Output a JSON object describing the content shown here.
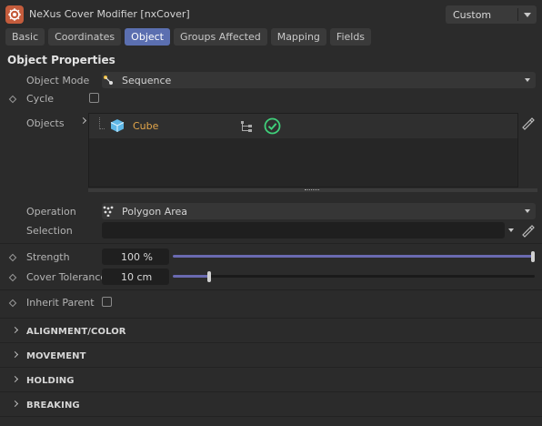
{
  "window": {
    "title": "NeXus Cover Modifier [nxCover]",
    "preset": "Custom"
  },
  "tabs": [
    {
      "label": "Basic",
      "active": false
    },
    {
      "label": "Coordinates",
      "active": false
    },
    {
      "label": "Object",
      "active": true
    },
    {
      "label": "Groups Affected",
      "active": false
    },
    {
      "label": "Mapping",
      "active": false
    },
    {
      "label": "Fields",
      "active": false
    }
  ],
  "section_title": "Object Properties",
  "object_mode": {
    "label": "Object Mode",
    "value": "Sequence"
  },
  "cycle": {
    "label": "Cycle",
    "checked": false
  },
  "objects": {
    "label": "Objects",
    "items": [
      {
        "name": "Cube",
        "enabled": true
      }
    ]
  },
  "operation": {
    "label": "Operation",
    "value": "Polygon Area"
  },
  "selection": {
    "label": "Selection",
    "value": ""
  },
  "strength": {
    "label": "Strength",
    "value": "100 %",
    "fraction": 1.0
  },
  "cover_tolerance": {
    "label": "Cover Tolerance",
    "value": "10 cm",
    "fraction": 0.1
  },
  "inherit_parent": {
    "label": "Inherit Parent",
    "checked": false
  },
  "groups": [
    {
      "label": "ALIGNMENT/COLOR"
    },
    {
      "label": "MOVEMENT"
    },
    {
      "label": "HOLDING"
    },
    {
      "label": "BREAKING"
    }
  ],
  "colors": {
    "accent": "#5b6fb0",
    "object_name": "#e3a64a",
    "check": "#3fcf7a",
    "cube": "#5fb7e6"
  }
}
